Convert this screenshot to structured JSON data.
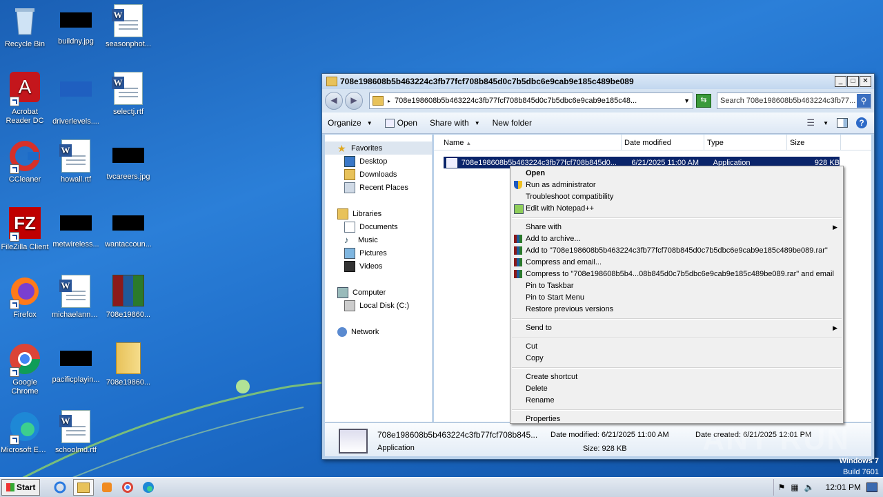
{
  "desktop": {
    "icons": [
      {
        "label": "Recycle Bin"
      },
      {
        "label": "buildny.jpg"
      },
      {
        "label": "seasonphot..."
      },
      {
        "label": "Acrobat Reader DC"
      },
      {
        "label": "driverlevels...."
      },
      {
        "label": "selectj.rtf"
      },
      {
        "label": "CCleaner"
      },
      {
        "label": "howall.rtf"
      },
      {
        "label": "tvcareers.jpg"
      },
      {
        "label": "FileZilla Client"
      },
      {
        "label": "metwireless..."
      },
      {
        "label": "wantaccoun..."
      },
      {
        "label": "Firefox"
      },
      {
        "label": "michaelanno..."
      },
      {
        "label": "708e19860..."
      },
      {
        "label": "Google Chrome"
      },
      {
        "label": "pacificplayin..."
      },
      {
        "label": "708e19860..."
      },
      {
        "label": "Microsoft Edge"
      },
      {
        "label": "schoolmd.rtf"
      }
    ],
    "watermark": "ANY RUN",
    "os_label": "Windows 7",
    "build_label": "Build 7601"
  },
  "window": {
    "title": "708e198608b5b463224c3fb77fcf708b845d0c7b5dbc6e9cab9e185c489be089",
    "address": "708e198608b5b463224c3fb77fcf708b845d0c7b5dbc6e9cab9e185c48...",
    "search_placeholder": "Search 708e198608b5b463224c3fb77...",
    "toolbar": {
      "organize": "Organize",
      "open": "Open",
      "share_with": "Share with",
      "new_folder": "New folder"
    },
    "nav": {
      "favorites": "Favorites",
      "desktop": "Desktop",
      "downloads": "Downloads",
      "recent_places": "Recent Places",
      "libraries": "Libraries",
      "documents": "Documents",
      "music": "Music",
      "pictures": "Pictures",
      "videos": "Videos",
      "computer": "Computer",
      "local_disk": "Local Disk (C:)",
      "network": "Network"
    },
    "columns": {
      "name": "Name",
      "date_modified": "Date modified",
      "type": "Type",
      "size": "Size"
    },
    "file": {
      "name": "708e198608b5b463224c3fb77fcf708b845d0...",
      "date": "6/21/2025 11:00 AM",
      "type": "Application",
      "size": "928 KB"
    },
    "status": {
      "name": "708e198608b5b463224c3fb77fcf708b845...",
      "type": "Application",
      "date_modified": "Date modified: 6/21/2025 11:00 AM",
      "size": "Size: 928 KB",
      "date_created": "Date created: 6/21/2025 12:01 PM"
    }
  },
  "context_menu": {
    "open": "Open",
    "run_as_admin": "Run as administrator",
    "troubleshoot": "Troubleshoot compatibility",
    "edit_notepad": "Edit with Notepad++",
    "share_with": "Share with",
    "add_archive": "Add to archive...",
    "add_to_rar": "Add to \"708e198608b5b463224c3fb77fcf708b845d0c7b5dbc6e9cab9e185c489be089.rar\"",
    "compress_email": "Compress and email...",
    "compress_to_rar_email": "Compress to \"708e198608b5b4...08b845d0c7b5dbc6e9cab9e185c489be089.rar\" and email",
    "pin_taskbar": "Pin to Taskbar",
    "pin_start": "Pin to Start Menu",
    "restore_versions": "Restore previous versions",
    "send_to": "Send to",
    "cut": "Cut",
    "copy": "Copy",
    "create_shortcut": "Create shortcut",
    "delete": "Delete",
    "rename": "Rename",
    "properties": "Properties"
  },
  "taskbar": {
    "start": "Start",
    "clock": "12:01 PM"
  }
}
